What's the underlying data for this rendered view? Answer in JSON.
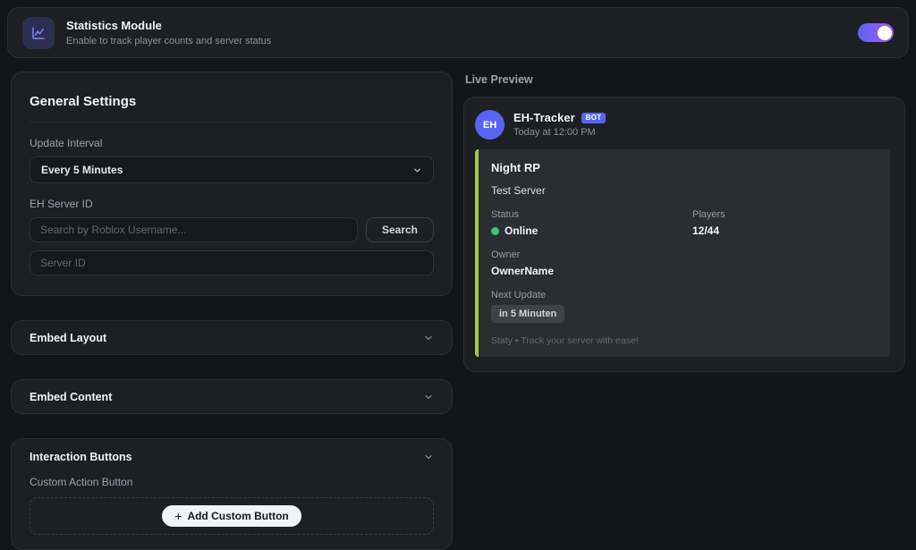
{
  "colors": {
    "accent_blurple": "#5865f2",
    "toggle_gradient_start": "#5b65f1",
    "toggle_gradient_end": "#a855f7",
    "embed_border": "#a3cc3e",
    "online_green": "#34c77b",
    "card_bg": "#1e1f23",
    "page_bg": "#141518"
  },
  "topbar": {
    "icon": "line-chart-icon",
    "title": "Statistics Module",
    "subtitle": "Enable to track player counts and server status",
    "toggle_state": "on"
  },
  "general_settings": {
    "title": "General Settings",
    "update_interval": {
      "label": "Update Interval",
      "selected_option": "Every 5 Minutes"
    },
    "eh_server_id": {
      "label": "EH Server ID",
      "search_placeholder": "Search by Roblox Username...",
      "search_button_label": "Search",
      "server_id_placeholder": "Server ID"
    }
  },
  "sections": {
    "embed_layout": {
      "title": "Embed Layout",
      "state": "collapsed"
    },
    "embed_content": {
      "title": "Embed Content",
      "state": "collapsed"
    },
    "interaction_buttons": {
      "title": "Interaction Buttons",
      "state": "expanded",
      "custom_action_label": "Custom Action Button",
      "add_button_plus": "+",
      "add_button_label": "Add Custom Button"
    }
  },
  "live_preview": {
    "heading": "Live Preview",
    "message": {
      "avatar_initials": "EH",
      "author_name": "EH-Tracker",
      "bot_badge": "BOT",
      "timestamp": "Today at 12:00 PM"
    },
    "embed": {
      "title": "Night RP",
      "description": "Test Server",
      "fields": {
        "status": {
          "label": "Status",
          "value": "Online"
        },
        "players": {
          "label": "Players",
          "value": "12/44"
        },
        "owner": {
          "label": "Owner",
          "value": "OwnerName"
        },
        "next_update": {
          "label": "Next Update",
          "value": "in 5 Minuten"
        }
      },
      "footer": "Staty • Track your server with ease!"
    }
  }
}
